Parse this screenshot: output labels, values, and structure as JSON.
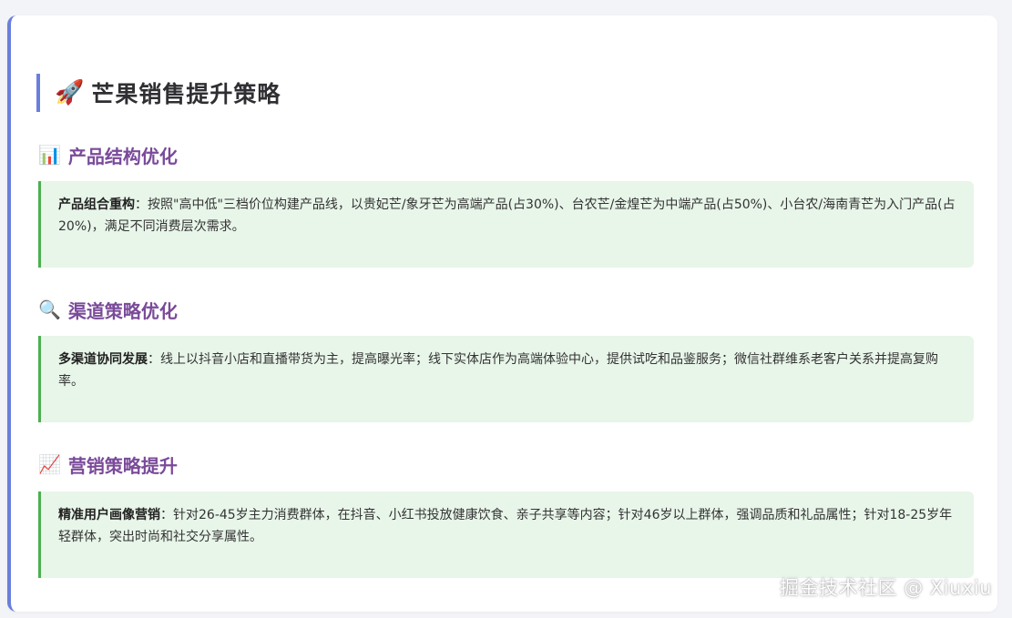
{
  "page": {
    "title_emoji": "🚀",
    "title": "芒果销售提升策略"
  },
  "sections": [
    {
      "emoji": "📊",
      "title": "产品结构优化",
      "bold": "产品组合重构",
      "text": "：按照\"高中低\"三档价位构建产品线，以贵妃芒/象牙芒为高端产品(占30%)、台农芒/金煌芒为中端产品(占50%)、小台农/海南青芒为入门产品(占20%)，满足不同消费层次需求。"
    },
    {
      "emoji": "🔍",
      "title": "渠道策略优化",
      "bold": "多渠道协同发展",
      "text": "：线上以抖音小店和直播带货为主，提高曝光率；线下实体店作为高端体验中心，提供试吃和品鉴服务；微信社群维系老客户关系并提高复购率。"
    },
    {
      "emoji": "📈",
      "title": "营销策略提升",
      "bold": "精准用户画像营销",
      "text": "：针对26-45岁主力消费群体，在抖音、小红书投放健康饮食、亲子共享等内容；针对46岁以上群体，强调品质和礼品属性；针对18-25岁年轻群体，突出时尚和社交分享属性。"
    }
  ],
  "watermark": "掘金技术社区 @ Xiuxiu",
  "colors": {
    "accent_bar": "#6a7fdc",
    "section_title": "#7a4a9a",
    "box_bg": "#e8f5e9",
    "box_border": "#4caf50"
  }
}
